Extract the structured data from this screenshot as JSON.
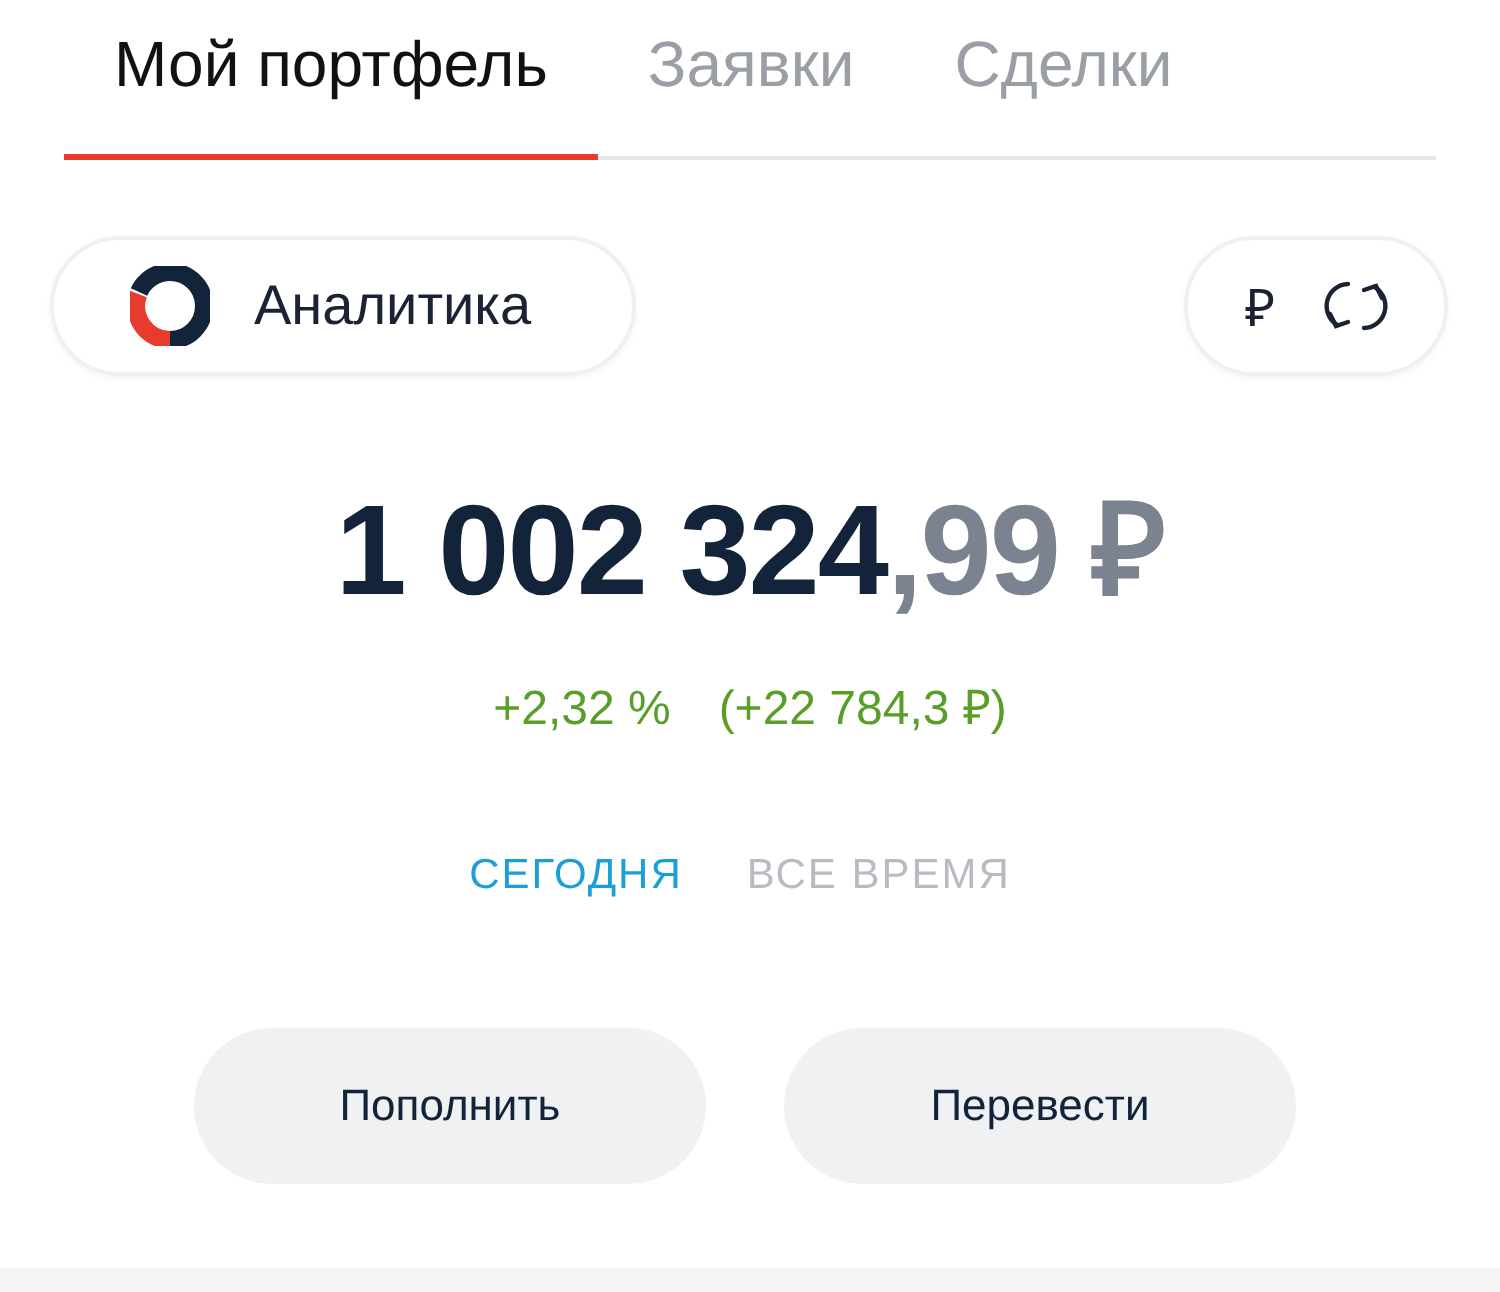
{
  "tabs": [
    {
      "label": "Мой портфель",
      "selected": true
    },
    {
      "label": "Заявки",
      "selected": false
    },
    {
      "label": "Сделки",
      "selected": false
    }
  ],
  "analytics_button": {
    "label": "Аналитика"
  },
  "currency_button": {
    "symbol": "₽"
  },
  "balance": {
    "integer": "1 002 324",
    "fraction": ",99 ₽"
  },
  "change": {
    "percent": "+2,32 %",
    "amount": "(+22 784,3 ₽)"
  },
  "periods": [
    {
      "label": "СЕГОДНЯ",
      "selected": true
    },
    {
      "label": "ВСЕ ВРЕМЯ",
      "selected": false
    }
  ],
  "actions": [
    "Пополнить",
    "Перевести"
  ]
}
